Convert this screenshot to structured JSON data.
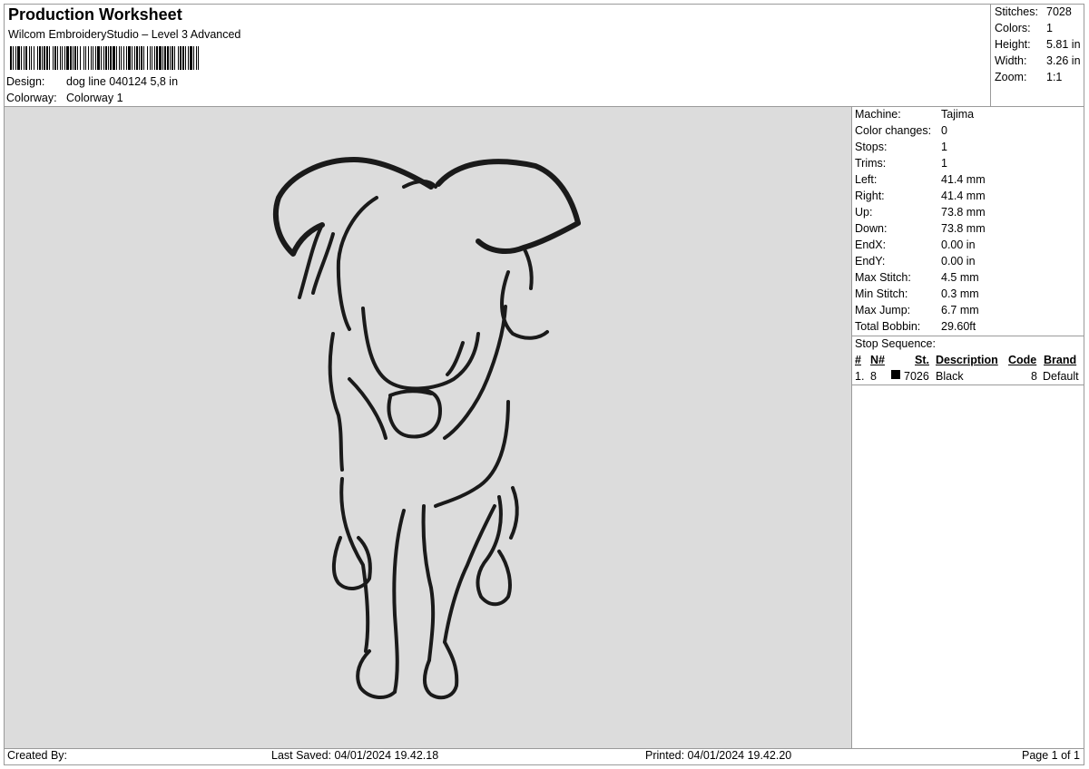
{
  "header": {
    "title": "Production Worksheet",
    "subtitle": "Wilcom EmbroideryStudio – Level 3 Advanced",
    "design_label": "Design:",
    "design_value": "dog line 040124 5,8 in",
    "colorway_label": "Colorway:",
    "colorway_value": "Colorway 1"
  },
  "summary": [
    {
      "label": "Stitches:",
      "value": "7028"
    },
    {
      "label": "Colors:",
      "value": "1"
    },
    {
      "label": "Height:",
      "value": "5.81 in"
    },
    {
      "label": "Width:",
      "value": "3.26 in"
    },
    {
      "label": "Zoom:",
      "value": "1:1"
    }
  ],
  "stats": [
    {
      "label": "Machine:",
      "value": "Tajima"
    },
    {
      "label": "Color changes:",
      "value": "0"
    },
    {
      "label": "Stops:",
      "value": "1"
    },
    {
      "label": "Trims:",
      "value": "1"
    },
    {
      "label": "Left:",
      "value": "41.4 mm"
    },
    {
      "label": "Right:",
      "value": "41.4 mm"
    },
    {
      "label": "Up:",
      "value": "73.8 mm"
    },
    {
      "label": "Down:",
      "value": "73.8 mm"
    },
    {
      "label": "EndX:",
      "value": "0.00 in"
    },
    {
      "label": "EndY:",
      "value": "0.00 in"
    },
    {
      "label": "Max Stitch:",
      "value": "4.5 mm"
    },
    {
      "label": "Min Stitch:",
      "value": "0.3 mm"
    },
    {
      "label": "Max Jump:",
      "value": "6.7 mm"
    },
    {
      "label": "Total Bobbin:",
      "value": "29.60ft"
    }
  ],
  "stop_sequence": {
    "label": "Stop Sequence:",
    "headers": {
      "num": "#",
      "n": "N#",
      "st": "St.",
      "description": "Description",
      "code": "Code",
      "brand": "Brand"
    },
    "rows": [
      {
        "num": "1.",
        "n": "8",
        "st": "7026",
        "description": "Black",
        "code": "8",
        "brand": "Default",
        "color": "#000000"
      }
    ]
  },
  "footer": {
    "created_by": "Created By:",
    "last_saved": "Last Saved: 04/01/2024 19.42.18",
    "printed": "Printed: 04/01/2024 19.42.20",
    "page": "Page 1 of 1"
  },
  "colors": {
    "canvas": "#dcdcdc",
    "stitch": "#1a1a1a",
    "border": "#9a9a9a"
  }
}
